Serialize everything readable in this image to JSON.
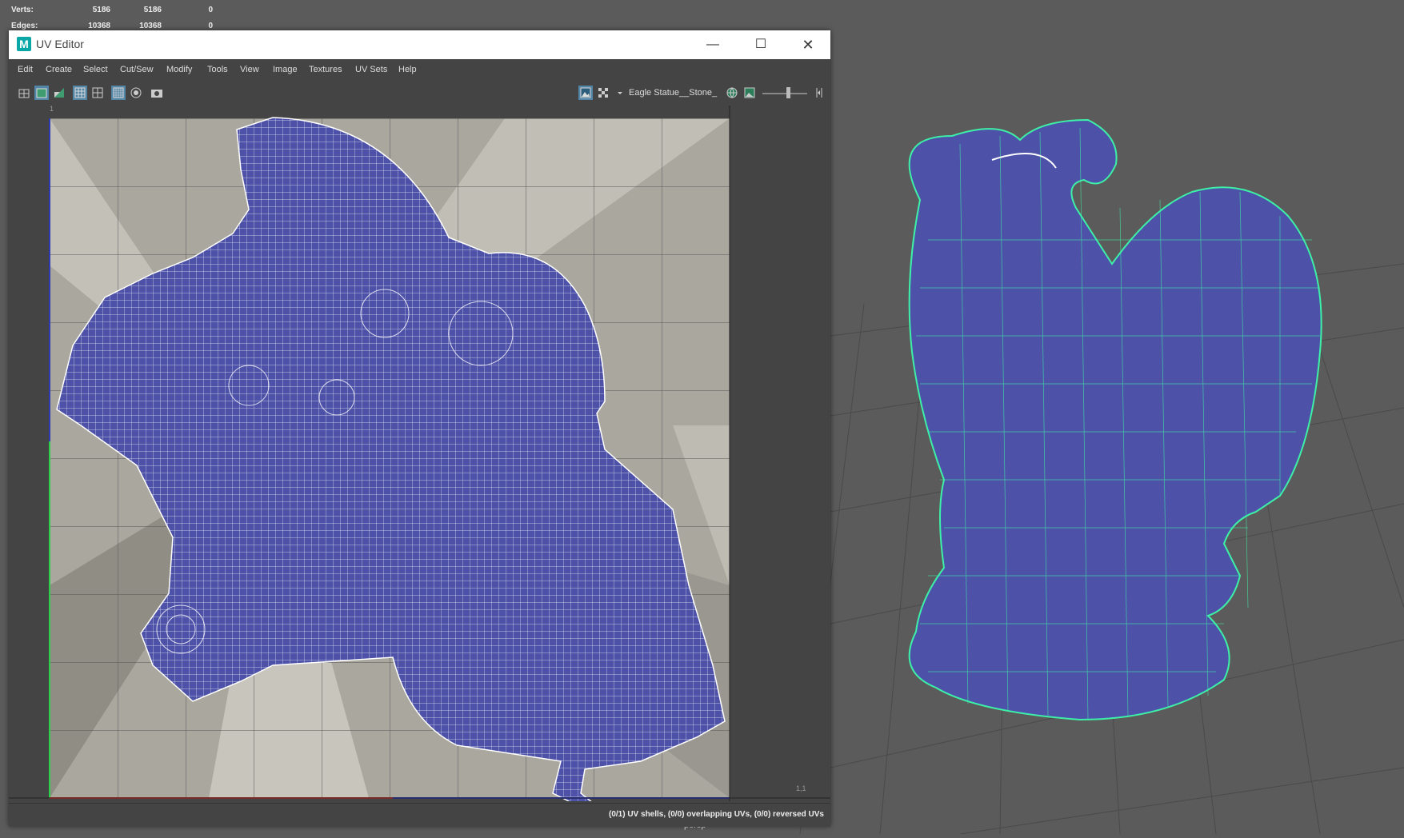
{
  "hud": {
    "verts_label": "Verts:",
    "verts_a": "5186",
    "verts_b": "5186",
    "verts_c": "0",
    "edges_label": "Edges:",
    "edges_a": "10368",
    "edges_b": "10368",
    "edges_c": "0"
  },
  "window": {
    "app_icon": "M",
    "title": "UV Editor",
    "minimize_icon": "—",
    "maximize_icon": "☐",
    "close_icon": "✕"
  },
  "menu": [
    "Edit",
    "Create",
    "Select",
    "Cut/Sew",
    "Modify",
    "Tools",
    "View",
    "Image",
    "Textures",
    "UV Sets",
    "Help"
  ],
  "toolbar": {
    "texture_name": "Eagle Statue__Stone_",
    "icons": [
      "wireframe-icon",
      "shaded-uv-icon",
      "distortion-icon",
      "grid-icon",
      "snap-grid-icon",
      "pixel-snap-icon",
      "isolate-icon",
      "snapshot-icon",
      "image-display-icon",
      "checker-icon",
      "dropdown-icon",
      "texture-globe-icon",
      "texture-image-icon",
      "more-icon"
    ]
  },
  "canvas": {
    "top_tick": "1",
    "corner_label": "1,1"
  },
  "status": "(0/1) UV shells, (0/0) overlapping UVs, (0/0) reversed UVs",
  "viewport": {
    "camera_label": "persp"
  },
  "colors": {
    "mesh_blue": "#4d52a8",
    "wire_green": "#3df0a8",
    "grid_bg": "#5b5b5b"
  }
}
